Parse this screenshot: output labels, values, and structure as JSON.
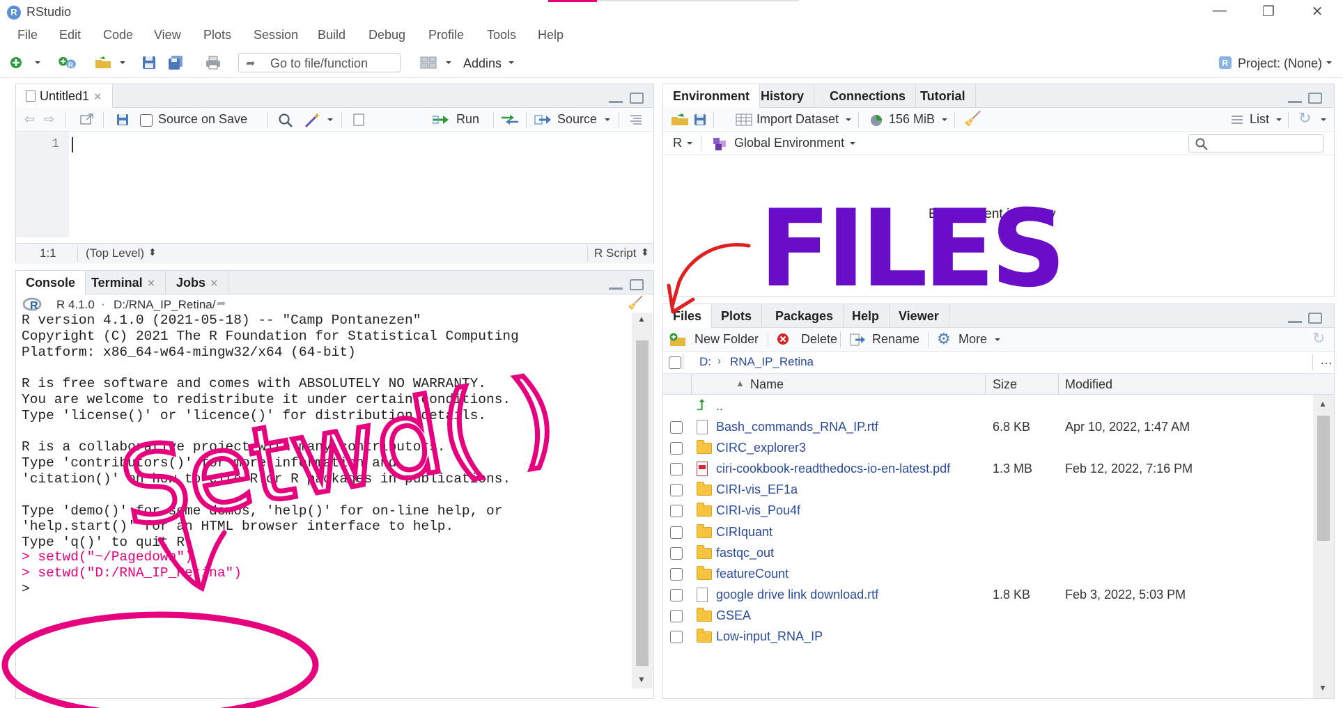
{
  "window": {
    "title": "RStudio",
    "minimize": "—",
    "restore": "❐",
    "close": "✕"
  },
  "menu": [
    "File",
    "Edit",
    "Code",
    "View",
    "Plots",
    "Session",
    "Build",
    "Debug",
    "Profile",
    "Tools",
    "Help"
  ],
  "toolbar": {
    "goto_placeholder": "Go to file/function",
    "addins": "Addins",
    "project": "Project: (None)"
  },
  "source_pane": {
    "tab": "Untitled1",
    "source_on_save": "Source on Save",
    "run": "Run",
    "source": "Source",
    "line_number": "1",
    "cursor_pos": "1:1",
    "scope": "(Top Level)",
    "file_type": "R Script"
  },
  "console_pane": {
    "tabs": [
      "Console",
      "Terminal",
      "Jobs"
    ],
    "r_version": "R 4.1.0",
    "dot": "·",
    "path": "D:/RNA_IP_Retina/",
    "lines": [
      "R version 4.1.0 (2021-05-18) -- \"Camp Pontanezen\"",
      "Copyright (C) 2021 The R Foundation for Statistical Computing",
      "Platform: x86_64-w64-mingw32/x64 (64-bit)",
      "",
      "R is free software and comes with ABSOLUTELY NO WARRANTY.",
      "You are welcome to redistribute it under certain conditions.",
      "Type 'license()' or 'licence()' for distribution details.",
      "",
      "R is a collaborative project with many contributors.",
      "Type 'contributors()' for more information and",
      "'citation()' on how to cite R or R packages in publications.",
      "",
      "Type 'demo()' for some demos, 'help()' for on-line help, or",
      "'help.start()' for an HTML browser interface to help.",
      "Type 'q()' to quit R."
    ],
    "commands": [
      "> setwd(\"~/Pagedown\")",
      "> setwd(\"D:/RNA_IP_Retina\")"
    ],
    "prompt": ">"
  },
  "env_pane": {
    "tabs": [
      "Environment",
      "History",
      "Connections",
      "Tutorial"
    ],
    "import_dataset": "Import Dataset",
    "memory": "156 MiB",
    "list": "List",
    "r_label": "R",
    "global_env": "Global Environment",
    "empty_msg": "Environment is empty"
  },
  "files_pane": {
    "tabs": [
      "Files",
      "Plots",
      "Packages",
      "Help",
      "Viewer"
    ],
    "new_folder": "New Folder",
    "delete": "Delete",
    "rename": "Rename",
    "more": "More",
    "breadcrumb_root": "D:",
    "breadcrumb_dir": "RNA_IP_Retina",
    "col_name": "Name",
    "col_size": "Size",
    "col_modified": "Modified",
    "parent": "..",
    "rows": [
      {
        "name": "Bash_commands_RNA_IP.rtf",
        "type": "doc",
        "size": "6.8 KB",
        "modified": "Apr 10, 2022, 1:47 AM"
      },
      {
        "name": "CIRC_explorer3",
        "type": "folder",
        "size": "",
        "modified": ""
      },
      {
        "name": "ciri-cookbook-readthedocs-io-en-latest.pdf",
        "type": "pdf",
        "size": "1.3 MB",
        "modified": "Feb 12, 2022, 7:16 PM"
      },
      {
        "name": "CIRI-vis_EF1a",
        "type": "folder",
        "size": "",
        "modified": ""
      },
      {
        "name": "CIRI-vis_Pou4f",
        "type": "folder",
        "size": "",
        "modified": ""
      },
      {
        "name": "CIRIquant",
        "type": "folder",
        "size": "",
        "modified": ""
      },
      {
        "name": "fastqc_out",
        "type": "folder",
        "size": "",
        "modified": ""
      },
      {
        "name": "featureCount",
        "type": "folder",
        "size": "",
        "modified": ""
      },
      {
        "name": "google drive link download.rtf",
        "type": "doc",
        "size": "1.8 KB",
        "modified": "Feb 3, 2022, 5:03 PM"
      },
      {
        "name": "GSEA",
        "type": "folder",
        "size": "",
        "modified": ""
      },
      {
        "name": "Low-input_RNA_IP",
        "type": "folder",
        "size": "",
        "modified": ""
      }
    ]
  },
  "annotations": {
    "files_word": "FILES",
    "setwd_word": "Setwd( )"
  },
  "colors": {
    "annotation_purple": "#6a0dc8",
    "annotation_pink": "#e6007e",
    "annotation_red": "#e02020",
    "link_blue": "#2a4b9b"
  }
}
